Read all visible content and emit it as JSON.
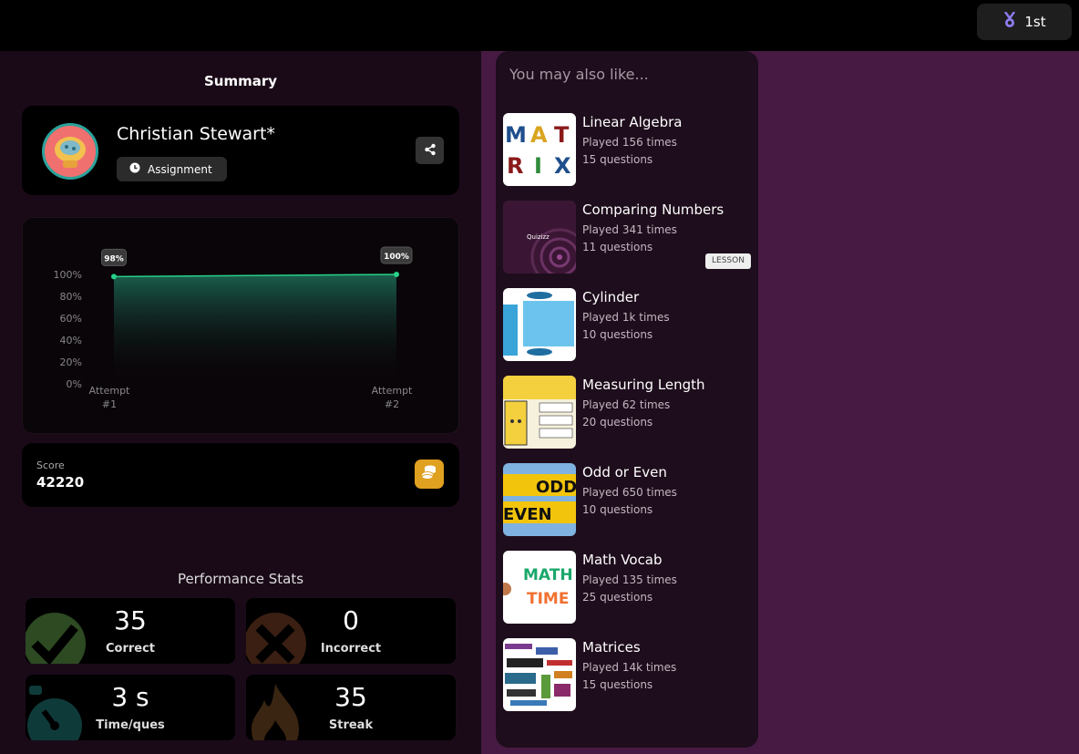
{
  "header": {
    "rank": "1st",
    "rank_icon": "medal-icon"
  },
  "summary": {
    "title": "Summary",
    "player_name": "Christian Stewart*",
    "mode_label": "Assignment"
  },
  "attempts_chart": {
    "chart_data": {
      "type": "area",
      "categories": [
        "Attempt #1",
        "Attempt #2"
      ],
      "x_labels": [
        [
          "Attempt",
          "#1"
        ],
        [
          "Attempt",
          "#2"
        ]
      ],
      "values": [
        98,
        100
      ],
      "data_labels": [
        "98%",
        "100%"
      ],
      "y_ticks": [
        "100%",
        "80%",
        "60%",
        "40%",
        "20%",
        "0%"
      ],
      "ylim": [
        0,
        100
      ],
      "line_color": "#27d18a"
    }
  },
  "score": {
    "label": "Score",
    "value": "42220"
  },
  "performance": {
    "title": "Performance Stats",
    "stats": [
      {
        "value": "35",
        "label": "Correct",
        "icon": "check-icon",
        "color": "#2d4a22"
      },
      {
        "value": "0",
        "label": "Incorrect",
        "icon": "cross-icon",
        "color": "#3a1f12"
      },
      {
        "value": "3 s",
        "label": "Time/ques",
        "icon": "stopwatch-icon",
        "color": "#0f3a3a"
      },
      {
        "value": "35",
        "label": "Streak",
        "icon": "flame-icon",
        "color": "#3a2512"
      }
    ]
  },
  "recommendations": {
    "heading": "You may also like...",
    "items": [
      {
        "title": "Linear Algebra",
        "played": "Played 156 times",
        "questions": "15 questions"
      },
      {
        "title": "Comparing Numbers",
        "played": "Played 341 times",
        "questions": "11 questions",
        "tag": "LESSON",
        "thumb_text": "Quizizz"
      },
      {
        "title": "Cylinder",
        "played": "Played 1k times",
        "questions": "10 questions"
      },
      {
        "title": "Measuring Length",
        "played": "Played 62 times",
        "questions": "20 questions"
      },
      {
        "title": "Odd or Even",
        "played": "Played 650 times",
        "questions": "10 questions",
        "thumb_words": [
          "ODD",
          "EVEN"
        ]
      },
      {
        "title": "Math Vocab",
        "played": "Played 135 times",
        "questions": "25 questions",
        "thumb_words": [
          "MATH",
          "TIME"
        ]
      },
      {
        "title": "Matrices",
        "played": "Played 14k times",
        "questions": "15 questions"
      }
    ]
  },
  "colors": {
    "accent_line": "#27d18a",
    "coin": "#e0a020",
    "panel_bg": "#1e0d1c",
    "page_bg": "#461a42"
  }
}
